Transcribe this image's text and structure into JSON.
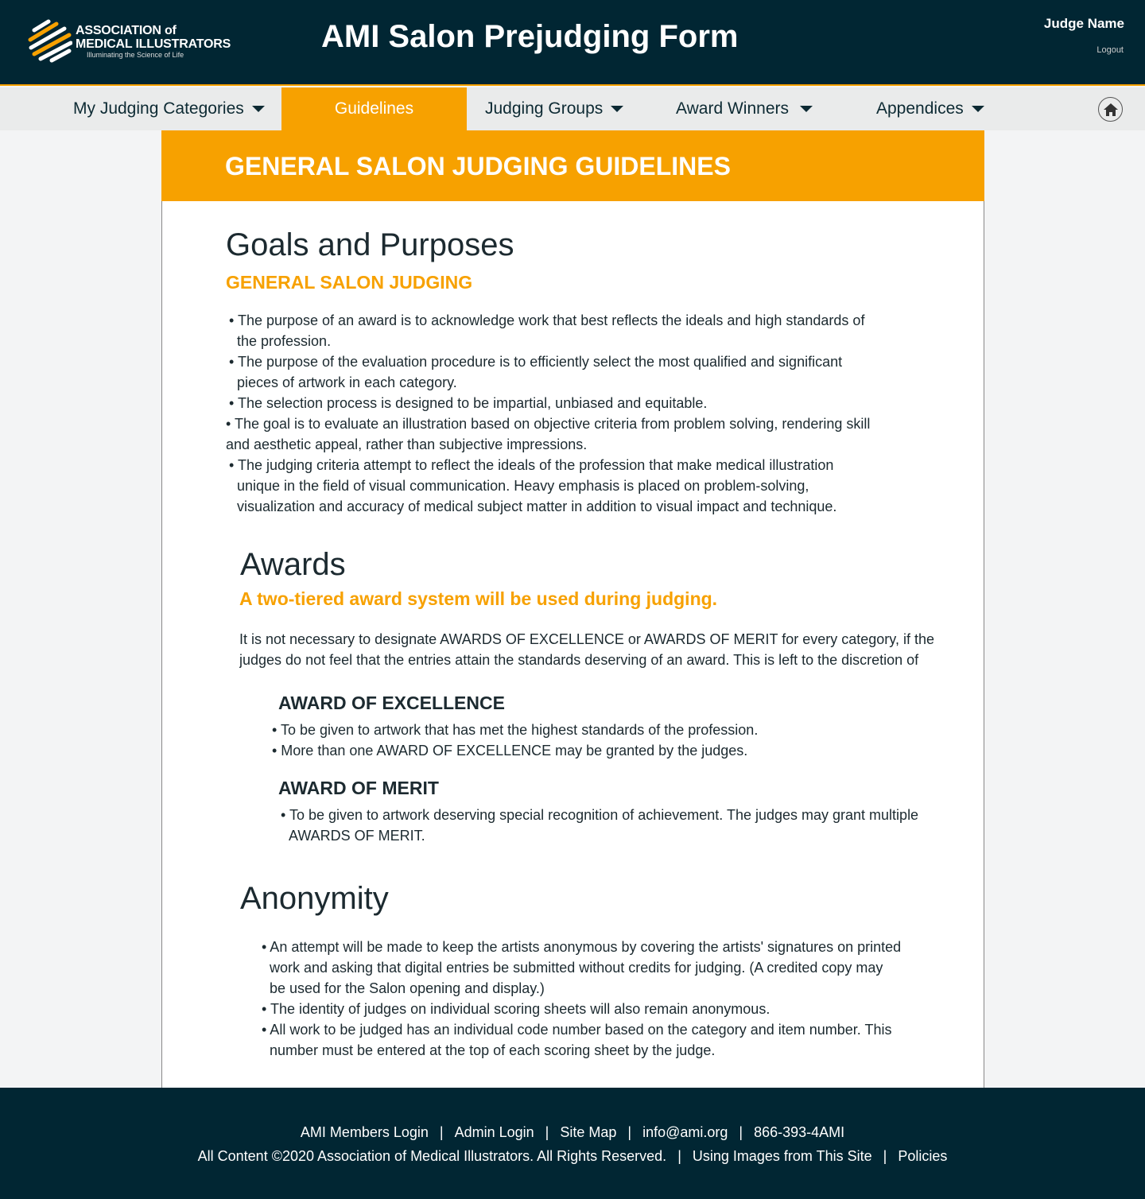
{
  "header": {
    "logo": {
      "line1": "ASSOCIATION of",
      "line2": "MEDICAL ILLUSTRATORS",
      "tagline": "Illuminating the Science of Life"
    },
    "title": "AMI Salon Prejudging Form",
    "judge_name": "Judge Name",
    "logout": "Logout"
  },
  "nav": {
    "items": [
      {
        "label": "My Judging Categories"
      },
      {
        "label": "Guidelines"
      },
      {
        "label": "Judging Groups"
      },
      {
        "label": "Award Winners"
      },
      {
        "label": "Appendices"
      }
    ],
    "home_icon": "home-icon",
    "accent": "#f7a100"
  },
  "main": {
    "banner": "GENERAL SALON JUDGING GUIDELINES",
    "goals": {
      "title": "Goals and Purposes",
      "subtitle": "GENERAL SALON JUDGING",
      "bullets": [
        "• The purpose of an award is to acknowledge work that best reflects the ideals and high standards of the profession.",
        "• The purpose of the evaluation procedure is to efficiently select the most qualified and significant pieces of artwork in each category.",
        "• The selection process is designed to be impartial, unbiased and equitable.",
        "• The goal is to evaluate an illustration based on objective criteria from problem solving, rendering skill and aesthetic appeal, rather than subjective impressions.",
        "• The judging criteria attempt to reflect the ideals of the profession that make medical illustration unique in the field of visual communication. Heavy emphasis is placed on problem-solving, visualization and accuracy of medical subject matter in addition to visual impact and technique."
      ]
    },
    "awards": {
      "title": "Awards",
      "subtitle": "A two-tiered award system will be used during judging.",
      "intro": "It is not necessary to designate AWARDS OF EXCELLENCE or AWARDS OF MERIT for every category, if the judges do not feel that the entries attain the standards deserving of an award. This is left to the discretion of",
      "excellence": {
        "title": "AWARD OF EXCELLENCE",
        "bullets": [
          "• To be given to artwork that has met the highest standards of the profession.",
          "• More than one AWARD OF EXCELLENCE may be granted by the judges."
        ]
      },
      "merit": {
        "title": "AWARD OF MERIT",
        "bullets": [
          "• To be given to artwork deserving special recognition of achievement. The judges may grant multiple AWARDS OF MERIT."
        ]
      }
    },
    "anonymity": {
      "title": "Anonymity",
      "bullets": [
        "• An attempt will be made to keep the artists anonymous by covering the artists' signatures on printed work and asking that digital entries be submitted without credits for judging. (A credited copy may be used for the Salon opening and display.)",
        "• The identity of judges on individual scoring sheets will also remain anonymous.",
        "• All work to be judged has an individual code number based on the category and item number. This number must be entered at the top of each scoring sheet by the judge."
      ]
    }
  },
  "footer": {
    "links": [
      "AMI Members Login",
      "Admin Login",
      "Site Map",
      "info@ami.org",
      "866-393-4AMI"
    ],
    "copyright": "All Content ©2020 Association of Medical Illustrators. All Rights Reserved.",
    "links2": [
      "Using Images from This Site",
      "Policies"
    ],
    "separator": "|"
  }
}
